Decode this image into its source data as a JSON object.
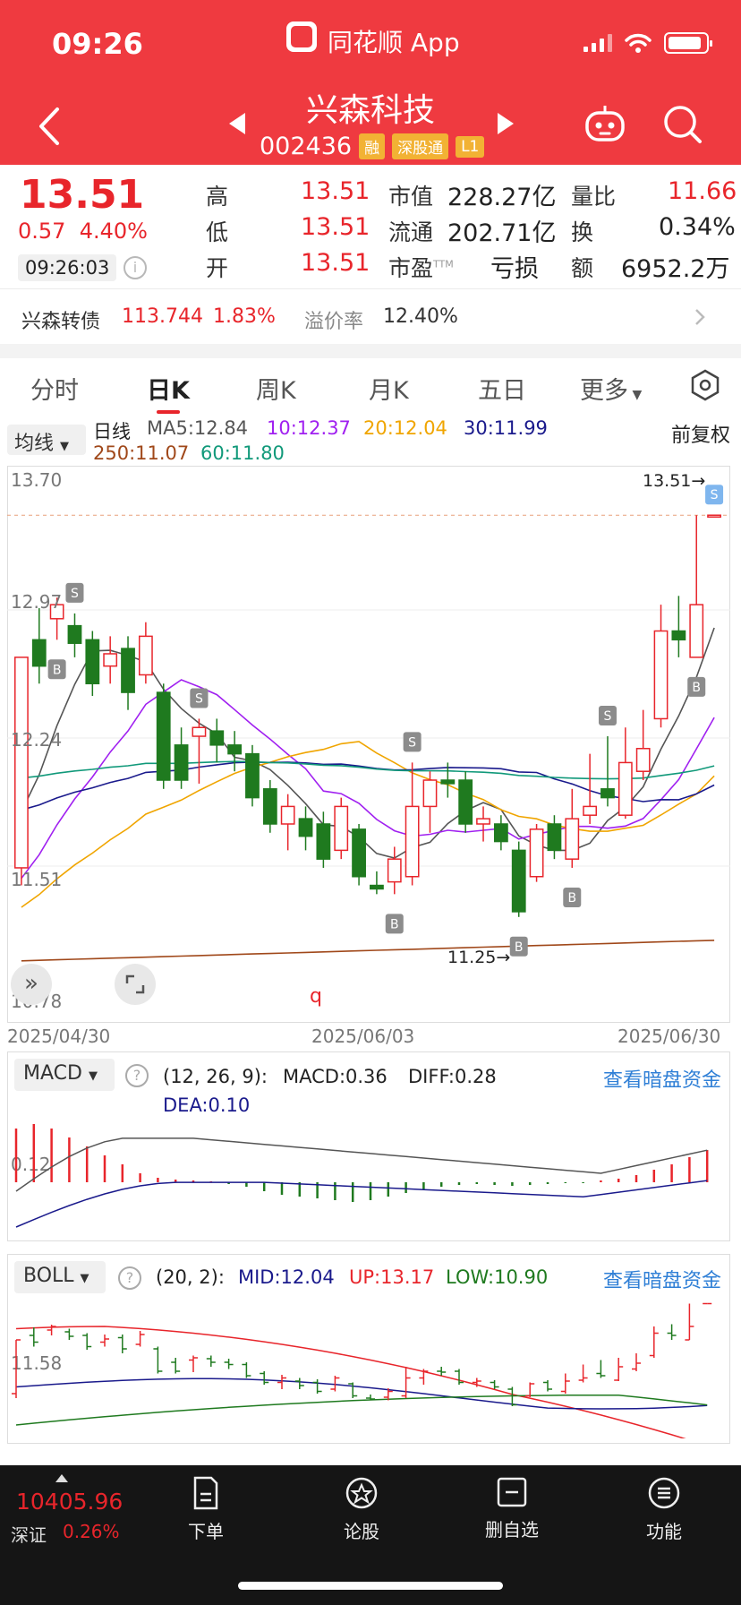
{
  "status": {
    "time": "09:26",
    "app_name": "同花顺 App"
  },
  "stock": {
    "name": "兴森科技",
    "code": "002436",
    "tags": [
      "融",
      "深股通",
      "L1"
    ]
  },
  "quote": {
    "price": "13.51",
    "change": "0.57",
    "change_pct": "4.40%",
    "time": "09:26:03",
    "high_label": "高",
    "high": "13.51",
    "low_label": "低",
    "low": "13.51",
    "open_label": "开",
    "open": "13.51",
    "mcap_label": "市值",
    "mcap": "228.27亿",
    "float_label": "流通",
    "float": "202.71亿",
    "pe_label": "市盈",
    "pe_sup": "TTM",
    "pe": "亏损",
    "vol_ratio_label": "量比",
    "vol_ratio": "11.66",
    "turnover_label": "换",
    "turnover": "0.34%",
    "amount_label": "额",
    "amount": "6952.2万"
  },
  "convertible": {
    "name": "兴森转债",
    "price": "113.744",
    "pct": "1.83%",
    "premium_label": "溢价率",
    "premium": "12.40%"
  },
  "tabs": [
    "分时",
    "日K",
    "周K",
    "月K",
    "五日",
    "更多"
  ],
  "active_tab": "日K",
  "ma_legend": {
    "dropdown": "均线",
    "period": "日线",
    "ma5": "MA5:12.84",
    "ma10": "10:12.37",
    "ma20": "20:12.04",
    "ma30": "30:11.99",
    "ma250": "250:11.07",
    "ma60": "60:11.80",
    "adjust": "前复权"
  },
  "colors": {
    "red": "#e8252b",
    "green": "#1f7a1f",
    "ma5": "#555555",
    "ma10": "#a020f0",
    "ma20": "#f0a500",
    "ma30": "#1a1a8c",
    "ma60": "#11997a",
    "ma250": "#a0481a",
    "blue_link": "#2f7fd6"
  },
  "chart_data": {
    "type": "candlestick",
    "y_top_label": "13.70",
    "y_labels": [
      "12.97",
      "12.24",
      "11.51"
    ],
    "y_bottom_label": "10.78",
    "ylim": [
      10.78,
      13.7
    ],
    "high_marker": "13.51→",
    "low_marker": "11.25→",
    "dates": [
      "2025/04/30",
      "2025/06/03",
      "2025/06/30"
    ],
    "candles": [
      [
        11.5,
        12.7,
        11.4,
        12.7
      ],
      [
        12.8,
        12.65,
        12.55,
        12.98
      ],
      [
        12.92,
        13.0,
        12.8,
        13.04
      ],
      [
        12.88,
        12.78,
        12.7,
        12.95
      ],
      [
        12.8,
        12.55,
        12.48,
        12.85
      ],
      [
        12.65,
        12.72,
        12.55,
        12.82
      ],
      [
        12.75,
        12.5,
        12.4,
        12.82
      ],
      [
        12.6,
        12.82,
        12.55,
        12.9
      ],
      [
        12.5,
        12.0,
        11.95,
        12.55
      ],
      [
        12.2,
        12.0,
        11.95,
        12.3
      ],
      [
        12.25,
        12.3,
        11.98,
        12.35
      ],
      [
        12.28,
        12.2,
        12.1,
        12.35
      ],
      [
        12.2,
        12.15,
        12.05,
        12.28
      ],
      [
        12.15,
        11.9,
        11.85,
        12.2
      ],
      [
        11.95,
        11.75,
        11.7,
        12.0
      ],
      [
        11.75,
        11.85,
        11.6,
        11.92
      ],
      [
        11.78,
        11.68,
        11.6,
        11.85
      ],
      [
        11.75,
        11.55,
        11.5,
        11.82
      ],
      [
        11.6,
        11.85,
        11.55,
        11.9
      ],
      [
        11.72,
        11.45,
        11.4,
        11.75
      ],
      [
        11.4,
        11.38,
        11.35,
        11.48
      ],
      [
        11.42,
        11.55,
        11.35,
        11.62
      ],
      [
        11.45,
        11.85,
        11.4,
        12.1
      ],
      [
        11.85,
        12.0,
        11.7,
        12.05
      ],
      [
        12.0,
        11.98,
        11.9,
        12.1
      ],
      [
        12.0,
        11.75,
        11.7,
        12.05
      ],
      [
        11.75,
        11.78,
        11.65,
        11.85
      ],
      [
        11.75,
        11.65,
        11.6,
        11.8
      ],
      [
        11.6,
        11.25,
        11.22,
        11.65
      ],
      [
        11.45,
        11.72,
        11.42,
        11.75
      ],
      [
        11.75,
        11.6,
        11.55,
        11.8
      ],
      [
        11.55,
        11.78,
        11.5,
        11.95
      ],
      [
        11.8,
        11.85,
        11.75,
        12.15
      ],
      [
        11.95,
        11.9,
        11.85,
        12.25
      ],
      [
        11.8,
        12.1,
        11.78,
        12.3
      ],
      [
        12.05,
        12.18,
        12.0,
        12.4
      ],
      [
        12.35,
        12.85,
        12.3,
        13.0
      ],
      [
        12.85,
        12.8,
        12.7,
        13.05
      ],
      [
        12.7,
        13.0,
        12.7,
        13.51
      ],
      [
        13.51,
        13.51,
        13.51,
        13.51
      ]
    ],
    "buy_sell_marks": [
      "S",
      "B",
      "B",
      "S",
      "S",
      "B",
      "S",
      "B",
      "S",
      "B",
      "S"
    ]
  },
  "macd": {
    "dropdown": "MACD",
    "params": "(12, 26, 9):",
    "macd": "MACD:0.36",
    "diff": "DIFF:0.28",
    "dea": "DEA:0.10",
    "axis": "0.12",
    "link": "查看暗盘资金"
  },
  "boll": {
    "dropdown": "BOLL",
    "params": "(20, 2):",
    "mid": "MID:12.04",
    "up": "UP:13.17",
    "low": "LOW:10.90",
    "axis": "11.58",
    "link": "查看暗盘资金"
  },
  "bottom": {
    "index_value": "10405.96",
    "index_name": "深证",
    "index_pct": "0.26%",
    "items": [
      "下单",
      "论股",
      "删自选",
      "功能"
    ]
  }
}
